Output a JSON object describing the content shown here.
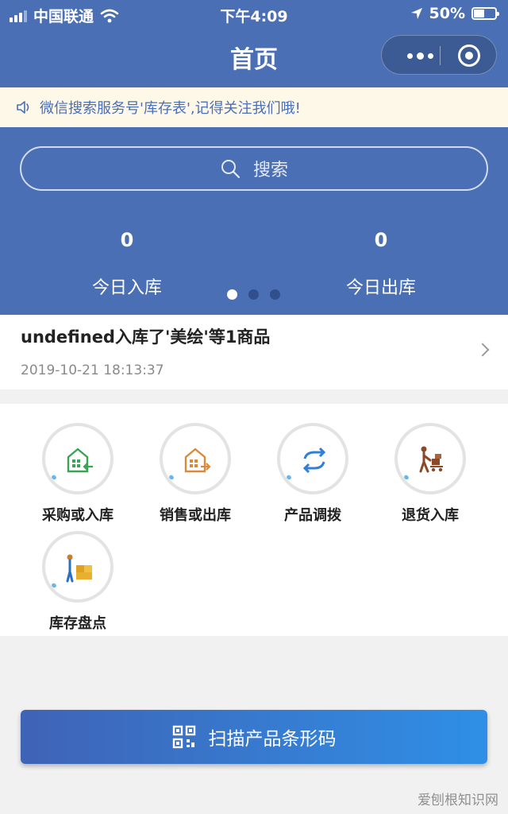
{
  "status_bar": {
    "carrier": "中国联通",
    "time": "下午4:09",
    "battery": "50%",
    "battery_level": 0.5
  },
  "nav": {
    "title": "首页"
  },
  "notice": {
    "text": "微信搜索服务号'库存表',记得关注我们哦!"
  },
  "search": {
    "placeholder": "搜索"
  },
  "stats": [
    {
      "value": "0",
      "label": "今日入库"
    },
    {
      "value": "0",
      "label": "今日出库"
    }
  ],
  "carousel": {
    "page_count": 3,
    "active_index": 0
  },
  "latest_record": {
    "title": "undefined入库了'美绘'等1商品",
    "timestamp": "2019-10-21 18:13:37"
  },
  "actions": [
    {
      "label": "采购或入库",
      "icon": "warehouse-in-icon",
      "color": "#3aa356"
    },
    {
      "label": "销售或出库",
      "icon": "warehouse-out-icon",
      "color": "#d98a3a"
    },
    {
      "label": "产品调拨",
      "icon": "transfer-icon",
      "color": "#2f7fd6"
    },
    {
      "label": "退货入库",
      "icon": "return-cart-icon",
      "color": "#8a4a2a"
    },
    {
      "label": "库存盘点",
      "icon": "inventory-check-icon",
      "color": "#e0a020"
    }
  ],
  "scan_button": {
    "label": "扫描产品条形码",
    "icon": "qr-code-icon"
  },
  "watermark": {
    "text": "爱刨根知识网"
  },
  "colors": {
    "primary": "#4a6fb5",
    "notice_bg": "#fdf8e8",
    "button_gradient_end": "#2f8fe6"
  }
}
